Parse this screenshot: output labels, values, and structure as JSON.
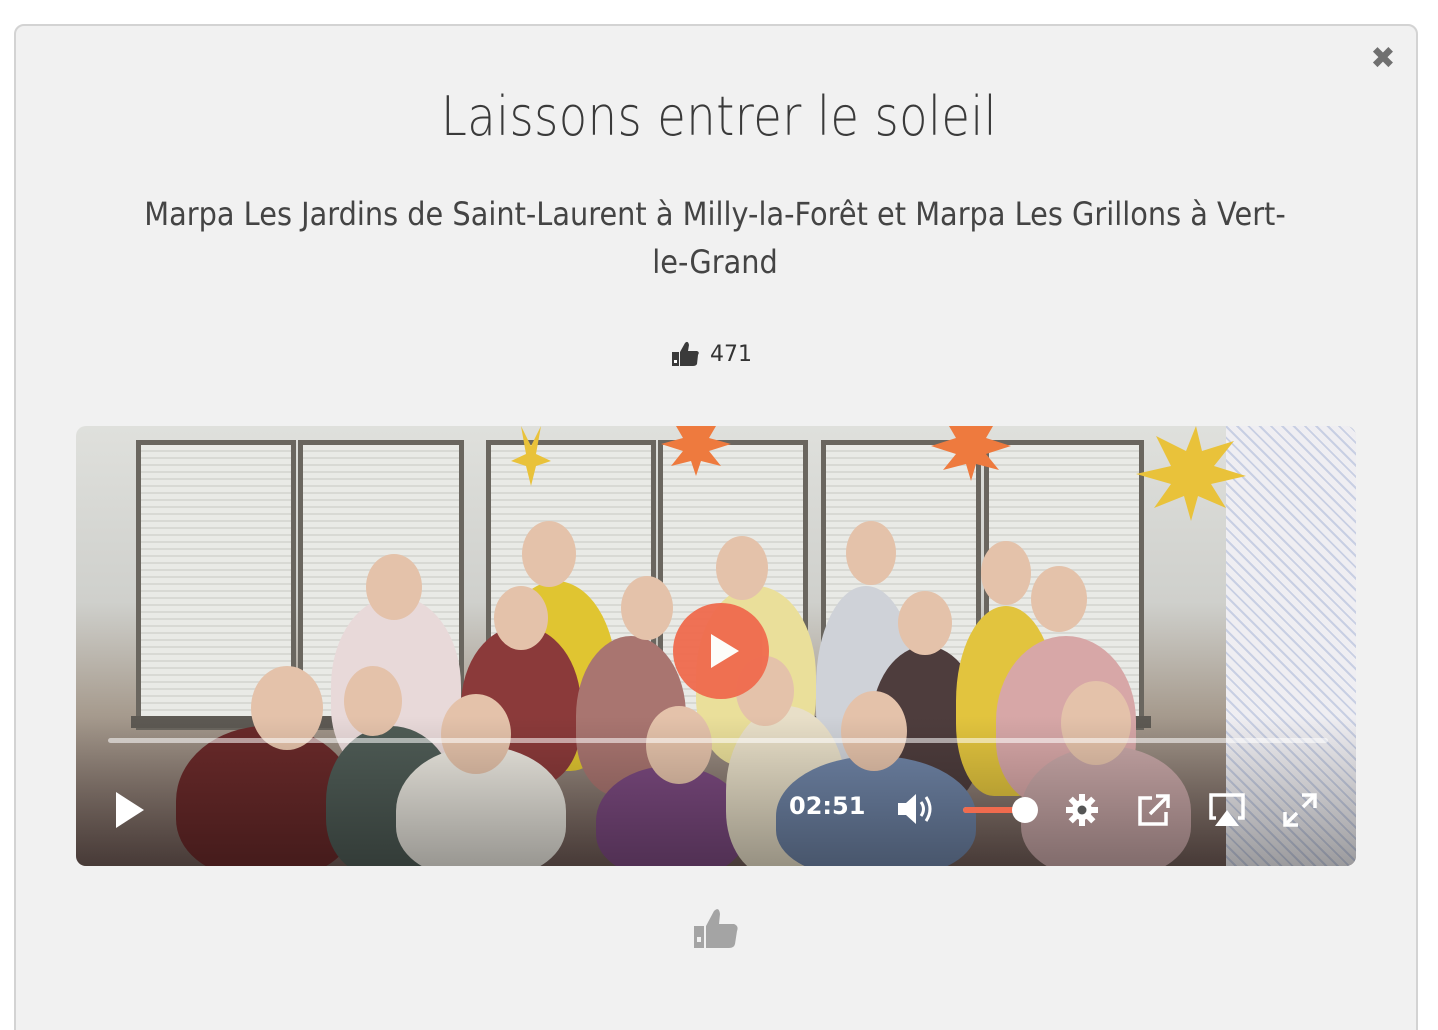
{
  "modal": {
    "close_label": "✖",
    "title": "Laissons entrer le soleil",
    "subtitle": "Marpa Les Jardins de Saint-Laurent à Milly-la-Forêt et Marpa Les Grillons à Vert-le-Grand",
    "like_count": "471"
  },
  "player": {
    "time": "02:51",
    "progress_fraction": 0.0,
    "volume_fraction": 0.78,
    "accent_color": "#f06b4e",
    "icons": [
      "play-icon",
      "volume-icon",
      "settings-icon",
      "external-link-icon",
      "airplay-icon",
      "fullscreen-icon"
    ]
  },
  "colors": {
    "background": "#f1f1f1",
    "text": "#3a3a3a",
    "accent": "#f06b4e"
  }
}
